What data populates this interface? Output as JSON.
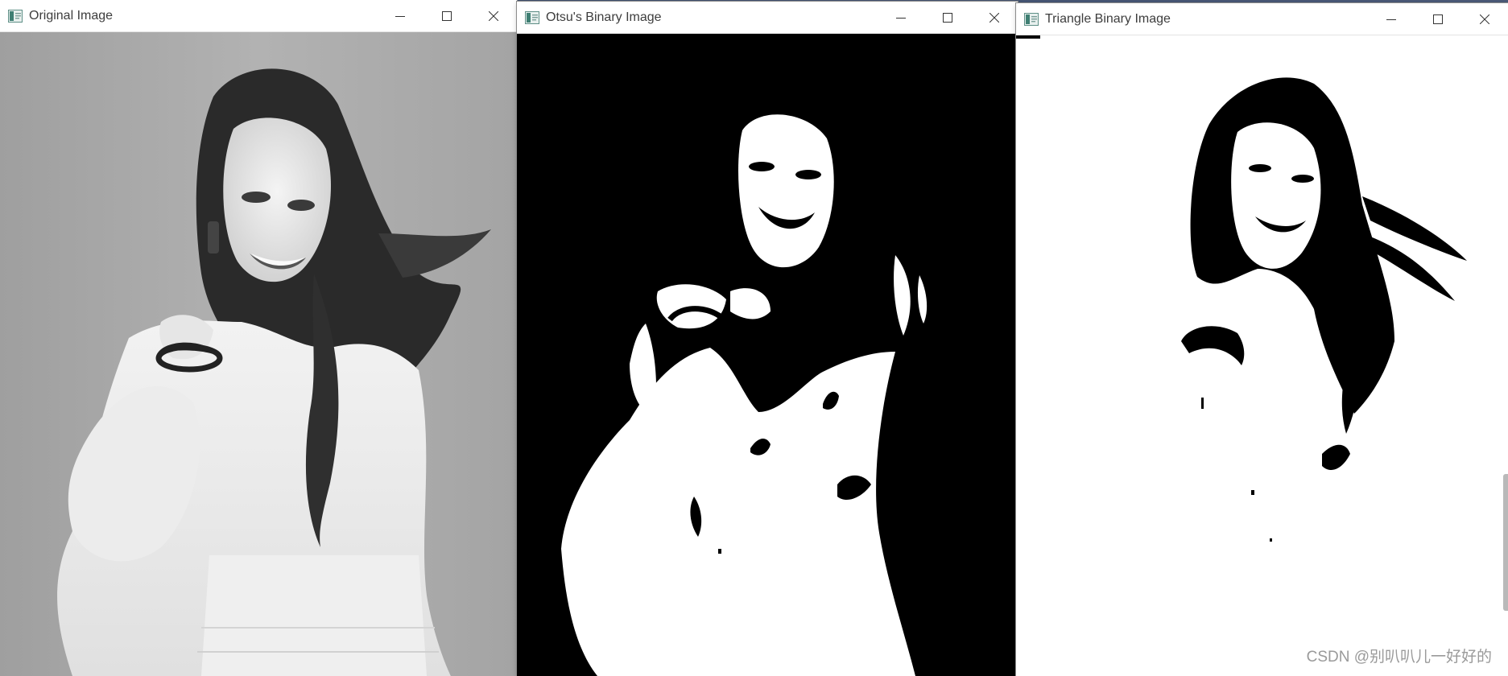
{
  "windows": [
    {
      "id": "original",
      "title": "Original Image"
    },
    {
      "id": "otsu",
      "title": "Otsu's Binary Image"
    },
    {
      "id": "triangle",
      "title": "Triangle Binary Image"
    }
  ],
  "controls": {
    "minimize_icon": "minimize-icon",
    "maximize_icon": "maximize-icon",
    "close_icon": "close-icon"
  },
  "watermark": "CSDN @别叭叭儿一好好的",
  "colors": {
    "titlebar": "#ffffff",
    "title_text": "#3d3d3d",
    "original_bg": "#a9a9a9",
    "binary_black": "#000000",
    "binary_white": "#ffffff"
  }
}
